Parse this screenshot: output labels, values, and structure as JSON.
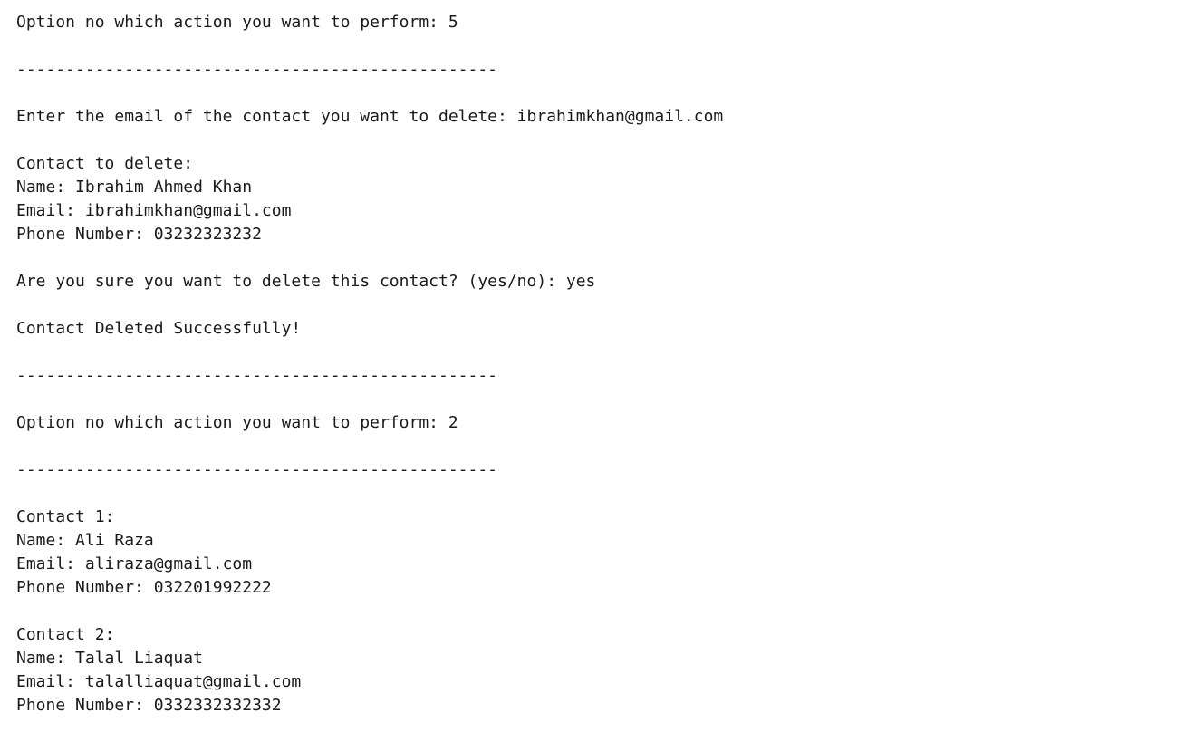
{
  "console": {
    "lines": [
      "Option no which action you want to perform: 5",
      "",
      "-------------------------------------------------",
      "",
      "Enter the email of the contact you want to delete: ibrahimkhan@gmail.com",
      "",
      "Contact to delete:",
      "Name: Ibrahim Ahmed Khan",
      "Email: ibrahimkhan@gmail.com",
      "Phone Number: 03232323232",
      "",
      "Are you sure you want to delete this contact? (yes/no): yes",
      "",
      "Contact Deleted Successfully!",
      "",
      "-------------------------------------------------",
      "",
      "Option no which action you want to perform: 2",
      "",
      "-------------------------------------------------",
      "",
      "Contact 1:",
      "Name: Ali Raza",
      "Email: aliraza@gmail.com",
      "Phone Number: 032201992222",
      "",
      "Contact 2:",
      "Name: Talal Liaquat",
      "Email: talalliaquat@gmail.com",
      "Phone Number: 0332332332332"
    ]
  }
}
